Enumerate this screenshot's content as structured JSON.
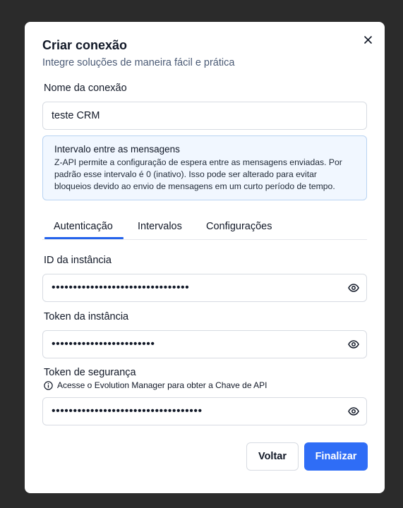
{
  "modal": {
    "title": "Criar conexão",
    "subtitle": "Integre soluções de maneira fácil e prática",
    "connection_name_label": "Nome da conexão",
    "connection_name_value": "teste CRM",
    "info": {
      "title": "Intervalo entre as mensagens",
      "line1": "Z-API permite a configuração de espera entre as mensagens enviadas. Por",
      "line2": "padrão esse intervalo é 0 (inativo). Isso pode ser alterado para evitar",
      "line3": "bloqueios devido ao envio de mensagens em um curto período de tempo."
    },
    "tabs": [
      {
        "label": "Autenticação",
        "active": true
      },
      {
        "label": "Intervalos",
        "active": false
      },
      {
        "label": "Configurações",
        "active": false
      }
    ],
    "fields": {
      "instance_id_label": "ID da instância",
      "instance_id_value": "••••••••••••••••••••••••••••••••",
      "instance_token_label": "Token da instância",
      "instance_token_value": "••••••••••••••••••••••••",
      "security_token_label": "Token de segurança",
      "security_token_hint": "Acesse o Evolution Manager para obter a Chave de API",
      "security_token_value": "•••••••••••••••••••••••••••••••••••"
    },
    "buttons": {
      "back": "Voltar",
      "finish": "Finalizar"
    },
    "icons": {
      "close": "close-icon",
      "eye": "eye-icon",
      "info": "info-icon"
    },
    "colors": {
      "accent": "#2f6df6",
      "info_background": "#f1f7ff",
      "info_border": "#b8d3f2"
    }
  }
}
